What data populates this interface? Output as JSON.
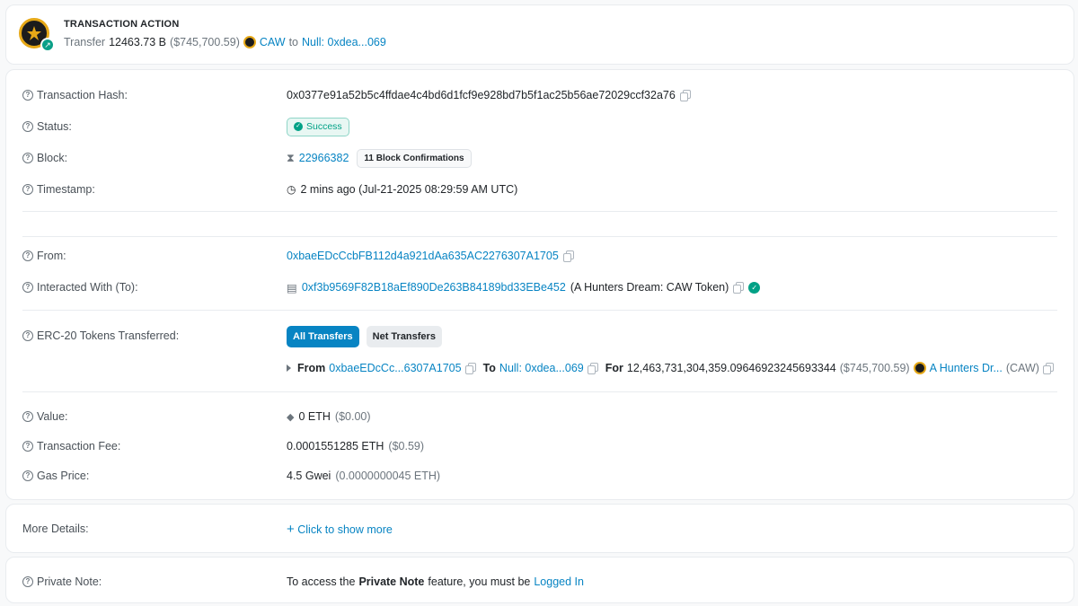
{
  "action": {
    "title": "TRANSACTION ACTION",
    "verb": "Transfer",
    "amount": "12463.73 B",
    "usd": "($745,700.59)",
    "token": "CAW",
    "to_word": "to",
    "recipient": "Null: 0xdea...069"
  },
  "details": {
    "hash": {
      "label": "Transaction Hash:",
      "value": "0x0377e91a52b5c4ffdae4c4bd6d1fcf9e928bd7b5f1ac25b56ae72029ccf32a76"
    },
    "status": {
      "label": "Status:",
      "value": "Success"
    },
    "block": {
      "label": "Block:",
      "value": "22966382",
      "confirmations": "11 Block Confirmations"
    },
    "timestamp": {
      "label": "Timestamp:",
      "value": "2 mins ago (Jul-21-2025 08:29:59 AM UTC)"
    },
    "from": {
      "label": "From:",
      "value": "0xbaeEDcCcbFB112d4a921dAa635AC2276307A1705"
    },
    "to": {
      "label": "Interacted With (To):",
      "address": "0xf3b9569F82B18aEf890De263B84189bd33EBe452",
      "name": "(A Hunters Dream: CAW Token)"
    },
    "erc20": {
      "label": "ERC-20 Tokens Transferred:",
      "tab_all": "All Transfers",
      "tab_net": "Net Transfers",
      "from_word": "From",
      "from_addr": "0xbaeEDcCc...6307A1705",
      "to_word": "To",
      "to_addr": "Null: 0xdea...069",
      "for_word": "For",
      "amount": "12,463,731,304,359.09646923245693344",
      "usd": "($745,700.59)",
      "token_name": "A Hunters Dr...",
      "token_symbol": "(CAW)"
    },
    "value": {
      "label": "Value:",
      "amount": "0 ETH",
      "usd": "($0.00)"
    },
    "fee": {
      "label": "Transaction Fee:",
      "amount": "0.0001551285 ETH",
      "usd": "($0.59)"
    },
    "gas": {
      "label": "Gas Price:",
      "amount": "4.5 Gwei",
      "eth": "(0.0000000045 ETH)"
    }
  },
  "more": {
    "label": "More Details:",
    "link": "Click to show more"
  },
  "note": {
    "label": "Private Note:",
    "text_before": "To access the",
    "text_bold": "Private Note",
    "text_middle": "feature, you must be",
    "link": "Logged In"
  },
  "colors": {
    "link": "#0784c3",
    "success": "#00a186",
    "token_gold": "#e6a817"
  }
}
